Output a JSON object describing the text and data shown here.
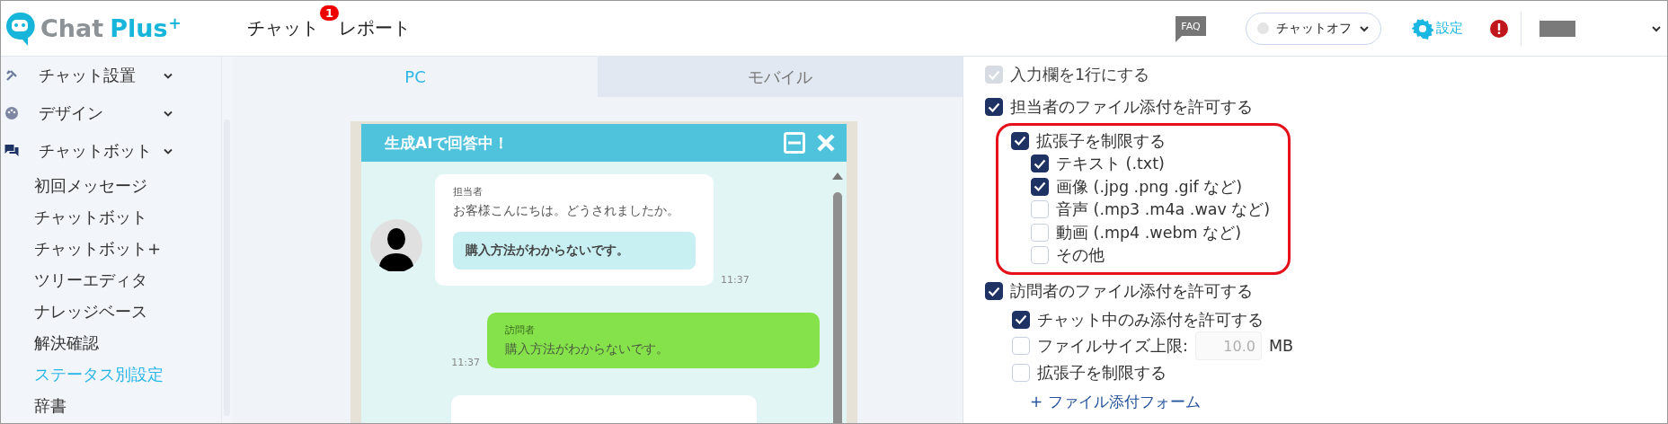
{
  "header": {
    "logo": {
      "word1": "Chat",
      "word2": "Plus",
      "mark": "+"
    },
    "nav": [
      {
        "label": "チャット",
        "badge": "1"
      },
      {
        "label": "レポート"
      }
    ],
    "faq": "FAQ",
    "status": {
      "label": "チャットオフ",
      "online": false
    },
    "settings_label": "設定",
    "alert": true
  },
  "sidebar": {
    "groups": [
      {
        "label": "チャット設置"
      },
      {
        "label": "デザイン"
      },
      {
        "label": "チャットボット",
        "children": [
          {
            "label": "初回メッセージ",
            "selected": false
          },
          {
            "label": "チャットボット",
            "selected": false
          },
          {
            "label": "チャットボット+",
            "selected": false
          },
          {
            "label": "ツリーエディタ",
            "selected": false
          },
          {
            "label": "ナレッジベース",
            "selected": false
          },
          {
            "label": "解決確認",
            "selected": false
          },
          {
            "label": "ステータス別設定",
            "selected": true
          },
          {
            "label": "辞書",
            "selected": false
          }
        ]
      }
    ]
  },
  "preview": {
    "tabs": [
      {
        "label": "PC",
        "selected": true
      },
      {
        "label": "モバイル",
        "selected": false
      }
    ],
    "widget": {
      "title": "生成AIで回答中！",
      "messages": [
        {
          "kind": "agent",
          "sender": "担当者",
          "text": "お客様こんにちは。どうされましたか。",
          "option": "購入方法がわからないです。",
          "time": "11:37"
        },
        {
          "kind": "visitor",
          "sender": "訪問者",
          "text": "購入方法がわからないです。",
          "time": "11:37"
        },
        {
          "kind": "agent_partial"
        }
      ]
    }
  },
  "settings": [
    {
      "kind": "checkbox",
      "label": "入力欄を1行にする",
      "checked": true,
      "disabled": true
    },
    {
      "kind": "checkbox",
      "label": "担当者のファイル添付を許可する",
      "checked": true,
      "children": [
        {
          "kind": "checkbox",
          "label": "拡張子を制限する",
          "checked": true,
          "highlighted": true,
          "children": [
            {
              "kind": "checkbox",
              "label": "テキスト (.txt)",
              "checked": true
            },
            {
              "kind": "checkbox",
              "label": "画像 (.jpg .png .gif など)",
              "checked": true
            },
            {
              "kind": "checkbox",
              "label": "音声 (.mp3 .m4a .wav など)",
              "checked": false
            },
            {
              "kind": "checkbox",
              "label": "動画 (.mp4 .webm など)",
              "checked": false
            },
            {
              "kind": "checkbox",
              "label": "その他",
              "checked": false
            }
          ]
        }
      ]
    },
    {
      "kind": "checkbox",
      "label": "訪問者のファイル添付を許可する",
      "checked": true,
      "children": [
        {
          "kind": "checkbox",
          "label": "チャット中のみ添付を許可する",
          "checked": true
        },
        {
          "kind": "size_limit",
          "label": "ファイルサイズ上限:",
          "checked": false,
          "value": "10.0",
          "field_disabled": true,
          "unit": "MB"
        },
        {
          "kind": "checkbox",
          "label": "拡張子を制限する",
          "checked": false
        },
        {
          "kind": "link",
          "label": "+ ファイル添付フォーム"
        }
      ]
    }
  ]
}
